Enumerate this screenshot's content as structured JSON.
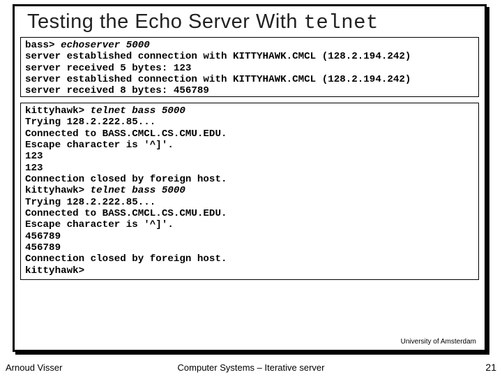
{
  "title_plain": "Testing the Echo Server With ",
  "title_mono": "telnet",
  "server_box": {
    "prompt1": "bass> ",
    "cmd1": "echoserver 5000",
    "l2": "server established connection with KITTYHAWK.CMCL (128.2.194.242)",
    "l3": "server received 5 bytes: 123",
    "l4": "server established connection with KITTYHAWK.CMCL (128.2.194.242)",
    "l5": "server received 8 bytes: 456789"
  },
  "client_box": {
    "prompt1": "kittyhawk> ",
    "cmd1": "telnet bass 5000",
    "l2": "Trying 128.2.222.85...",
    "l3": "Connected to BASS.CMCL.CS.CMU.EDU.",
    "l4": "Escape character is '^]'.",
    "l5": "123",
    "l6": "123",
    "l7": "Connection closed by foreign host.",
    "prompt2": "kittyhawk> ",
    "cmd2": "telnet bass 5000",
    "l9": "Trying 128.2.222.85...",
    "l10": "Connected to BASS.CMCL.CS.CMU.EDU.",
    "l11": "Escape character is '^]'.",
    "l12": "456789",
    "l13": "456789",
    "l14": "Connection closed by foreign host.",
    "l15": "kittyhawk>"
  },
  "attribution": "University of Amsterdam",
  "footer": {
    "left": "Arnoud Visser",
    "center": "Computer Systems – Iterative server",
    "right": "21"
  }
}
